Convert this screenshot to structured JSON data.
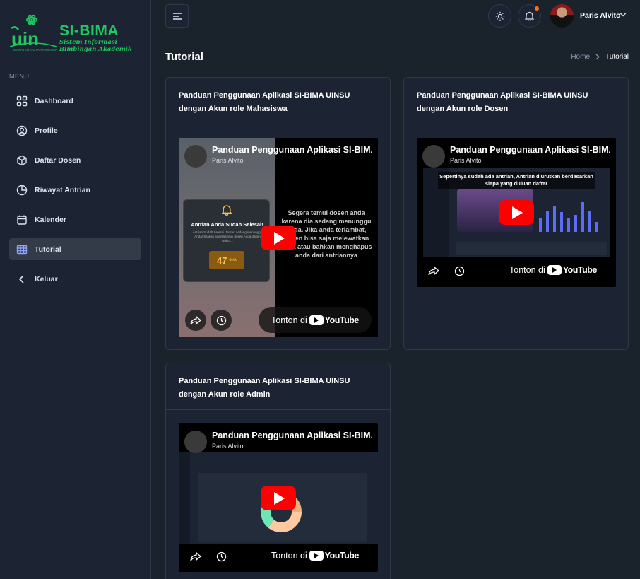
{
  "brand": {
    "title": "SI-BIMA",
    "subtitle_line1": "Sistem Informasi",
    "subtitle_line2": "Bimbingan Akademik",
    "caption": "SUMATERA UTARA MEDAN"
  },
  "sidebar": {
    "menu_label": "MENU",
    "items": [
      {
        "label": "Dashboard",
        "icon": "grid-icon",
        "active": false
      },
      {
        "label": "Profile",
        "icon": "user-circle-icon",
        "active": false
      },
      {
        "label": "Daftar Dosen",
        "icon": "box-icon",
        "active": false
      },
      {
        "label": "Riwayat Antrian",
        "icon": "pie-chart-icon",
        "active": false
      },
      {
        "label": "Kalender",
        "icon": "calendar-icon",
        "active": false
      },
      {
        "label": "Tutorial",
        "icon": "table-icon",
        "active": true
      },
      {
        "label": "Keluar",
        "icon": "chevron-left-icon",
        "active": false
      }
    ]
  },
  "header": {
    "user_name": "Paris Alvito",
    "notification_dot_color": "#f97316"
  },
  "page": {
    "title": "Tutorial",
    "breadcrumb_home": "Home",
    "breadcrumb_current": "Tutorial"
  },
  "cards": [
    {
      "title": "Panduan Penggunaan Aplikasi SI-BIMA UINSU dengan Akun role Mahasiswa",
      "video_title": "Panduan Penggunaan Aplikasi SI-BIMA",
      "channel": "Paris Alvito",
      "watch_label": "Tonton di",
      "thumb_popup_title": "Antrian Anda Sudah Selesai!",
      "thumb_popup_body": "Antrian Sudah Selesai. Dosen sedang menunggu Anda! Silakan segera temui dosen Anda dalam waktu...",
      "thumb_counter": "47",
      "thumb_counter_unit": "detik",
      "thumb_text": "Segera temui dosen anda karena dia sedang menunggu anda. Jika anda terlambat, dosen bisa saja melewatkan anda atau bahkan menghapus anda dari antriannya"
    },
    {
      "title": "Panduan Penggunaan Aplikasi SI-BIMA UINSU dengan Akun role Dosen",
      "video_title": "Panduan Penggunaan Aplikasi SI-BIMA",
      "channel": "Paris Alvito",
      "watch_label": "Tonton di",
      "thumb_caption": "Sepertinya sudah ada antrian, Antrian diurutkan berdasarkan siapa yang duluan daftar"
    },
    {
      "title": "Panduan Penggunaan Aplikasi SI-BIMA UINSU dengan Akun role Admin",
      "video_title": "Panduan Penggunaan Aplikasi SI-BIMA",
      "channel": "Paris Alvito",
      "watch_label": "Tonton di"
    }
  ],
  "youtube_label": "YouTube",
  "colors": {
    "background": "#1a222c",
    "surface": "#1c2434",
    "border": "#2e3a47",
    "brand_green": "#22c55e",
    "play_red": "#ff0000"
  }
}
